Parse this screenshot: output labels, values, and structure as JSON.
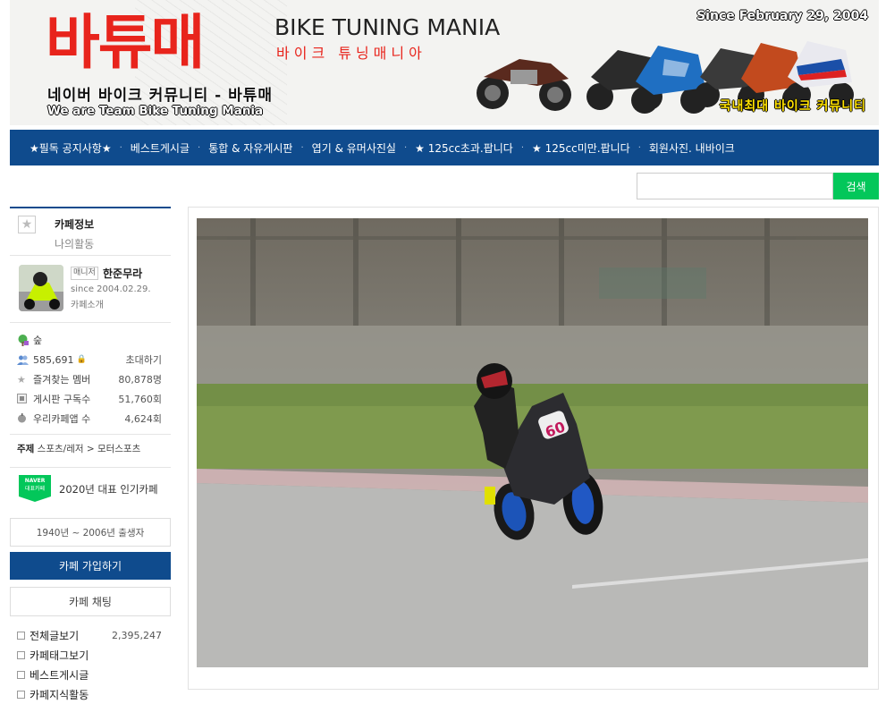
{
  "banner": {
    "logo": "바튜매",
    "sub_kr": "네이버 바이크 커뮤니티 - 바튜매",
    "sub_en": "We are Team Bike Tuning Mania",
    "title_en": "BIKE TUNING MANIA",
    "title_kr": "바이크 튜닝매니아",
    "since": "Since February 29, 2004",
    "badge": "국내최대 바이크 커뮤니티"
  },
  "nav": {
    "items": [
      "★필독 공지사항★",
      "베스트게시글",
      "통합 & 자유게시판",
      "엽기 & 유머사진실",
      "★ 125cc초과.팝니다",
      "★ 125cc미만.팝니다",
      "회원사진. 내바이크"
    ],
    "separator": "·"
  },
  "search": {
    "button": "검색",
    "value": ""
  },
  "sidebar": {
    "cafe_info": "카페정보",
    "my_activity": "나의활동",
    "manager_tag": "매니저",
    "manager_name": "한준무라",
    "since": "since 2004.02.29.",
    "intro": "카페소개",
    "level": "숲",
    "members": "585,691",
    "invite": "초대하기",
    "stats": [
      {
        "label": "즐겨찾는 멤버",
        "value": "80,878명"
      },
      {
        "label": "게시판 구독수",
        "value": "51,760회"
      },
      {
        "label": "우리카페앱 수",
        "value": "4,624회"
      }
    ],
    "topic_label": "주제",
    "topic_value": "스포츠/레저 > 모터스포츠",
    "naver_badge_top": "NAVER",
    "naver_badge_bottom": "대표카페",
    "naver_text": "2020년 대표 인기카페",
    "birth_range": "1940년 ~ 2006년 출생자",
    "join": "카페 가입하기",
    "chat": "카페 채팅",
    "menu": [
      {
        "label": "전체글보기",
        "count": "2,395,247"
      },
      {
        "label": "카페태그보기",
        "count": ""
      },
      {
        "label": "베스트게시글",
        "count": ""
      },
      {
        "label": "카페지식활동",
        "count": ""
      }
    ]
  },
  "photo": {
    "number_plate": "60"
  }
}
